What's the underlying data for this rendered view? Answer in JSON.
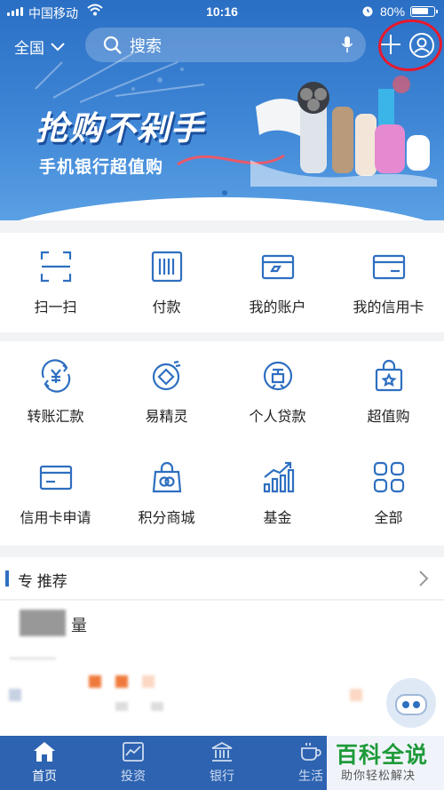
{
  "status_bar": {
    "carrier": "中国移动",
    "time": "10:16",
    "battery_percent": "80%",
    "battery_level": 0.8
  },
  "header": {
    "region": "全国",
    "search_placeholder": "搜索"
  },
  "banner": {
    "title": "抢购不剁手",
    "subtitle": "手机银行超值购",
    "page_count": 1,
    "active_page": 1
  },
  "quick_actions": [
    {
      "label": "扫一扫",
      "icon": "scan-icon"
    },
    {
      "label": "付款",
      "icon": "barcode-icon"
    },
    {
      "label": "我的账户",
      "icon": "account-card-icon"
    },
    {
      "label": "我的信用卡",
      "icon": "credit-card-icon"
    }
  ],
  "services": [
    {
      "label": "转账汇款",
      "icon": "transfer-icon"
    },
    {
      "label": "易精灵",
      "icon": "sprite-icon"
    },
    {
      "label": "个人贷款",
      "icon": "loan-icon"
    },
    {
      "label": "超值购",
      "icon": "shopping-bag-icon"
    },
    {
      "label": "信用卡申请",
      "icon": "card-apply-icon"
    },
    {
      "label": "积分商城",
      "icon": "points-mall-icon"
    },
    {
      "label": "基金",
      "icon": "fund-chart-icon"
    },
    {
      "label": "全部",
      "icon": "all-grid-icon"
    }
  ],
  "recommend": {
    "title": "专 推荐",
    "line2": "量"
  },
  "tabbar": [
    {
      "label": "首页",
      "icon": "home-icon",
      "active": true
    },
    {
      "label": "投资",
      "icon": "invest-chart-icon",
      "active": false
    },
    {
      "label": "银行",
      "icon": "bank-icon",
      "active": false
    },
    {
      "label": "生活",
      "icon": "life-cup-icon",
      "active": false
    }
  ],
  "watermark": {
    "title": "百科全说",
    "subtitle": "助你轻松解决"
  },
  "colors": {
    "brand_blue": "#2d63b0",
    "icon_blue": "#2e6fc0",
    "annotation_red": "#e8182d"
  }
}
